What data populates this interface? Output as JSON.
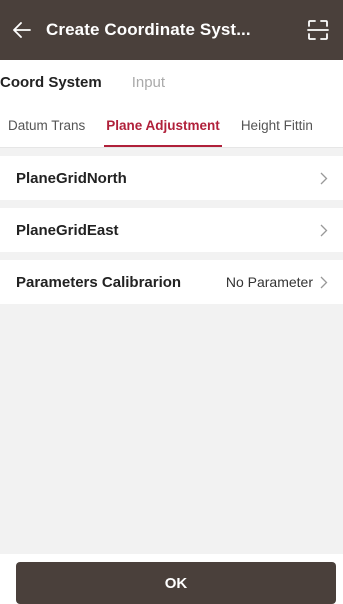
{
  "header": {
    "title": "Create Coordinate Syst...",
    "back_icon": "arrow-left-icon",
    "scan_icon": "scan-icon",
    "background": "#4a403b"
  },
  "top_tabs": [
    {
      "label": "Coord System",
      "active": true
    },
    {
      "label": "Input",
      "active": false
    }
  ],
  "sub_tabs": [
    {
      "label": "Datum Trans",
      "active": false
    },
    {
      "label": "Plane Adjustment",
      "active": true
    },
    {
      "label": "Height Fittin",
      "active": false
    }
  ],
  "accent_color": "#b0203a",
  "rows": [
    {
      "label": "PlaneGridNorth",
      "value": ""
    },
    {
      "label": "PlaneGridEast",
      "value": ""
    },
    {
      "label": "Parameters Calibrarion",
      "value": "No Parameter"
    }
  ],
  "ok_button": {
    "label": "OK"
  }
}
